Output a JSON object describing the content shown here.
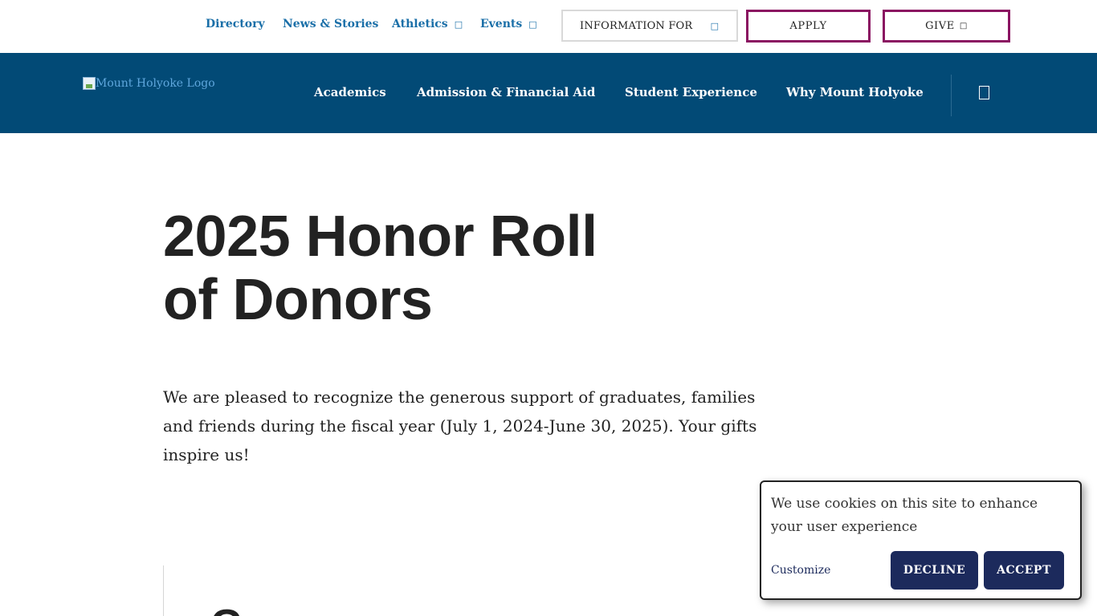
{
  "utility": {
    "links": [
      {
        "label": "Directory"
      },
      {
        "label": "News & Stories"
      },
      {
        "label": "Athletics",
        "chevron": ""
      },
      {
        "label": "Events",
        "chevron": ""
      }
    ],
    "info_for": {
      "label": "INFORMATION FOR",
      "chevron": ""
    },
    "apply_label": "APPLY",
    "give_label": "GIVE",
    "give_chevron": ""
  },
  "nav": {
    "logo_alt": "Mount Holyoke Logo",
    "items": [
      {
        "label": "Academics"
      },
      {
        "label": "Admission & Financial Aid"
      },
      {
        "label": "Student Experience"
      },
      {
        "label": "Why Mount Holyoke"
      }
    ]
  },
  "content": {
    "title_line1": "2025 Honor Roll",
    "title_line2": "of Donors",
    "intro": "We are pleased to recognize the generous support of graduates, families and friends during the fiscal year (July 1, 2024-June 30, 2025). Your gifts inspire us!",
    "section_peek": "Gr..."
  },
  "cookie": {
    "message": "We use cookies on this site to enhance your user experience",
    "customize_label": "Customize",
    "decline_label": "DECLINE",
    "accept_label": "ACCEPT"
  },
  "colors": {
    "nav_bg": "#024a76",
    "link_blue": "#1a6fa8",
    "accent_magenta": "#8a1361",
    "cookie_button": "#1c2a5c"
  }
}
